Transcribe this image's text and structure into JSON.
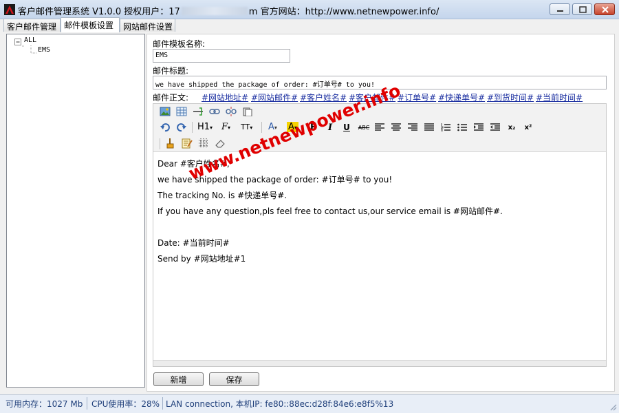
{
  "window": {
    "title_prefix": "客户邮件管理系统 V1.0.0 授权用户：17",
    "title_suffix": "m 官方网站：http://www.netnewpower.info/"
  },
  "tabs": [
    {
      "label": "客户邮件管理",
      "active": false
    },
    {
      "label": "邮件模板设置",
      "active": true
    },
    {
      "label": "网站邮件设置",
      "active": false
    }
  ],
  "tree": {
    "root": "ALL",
    "children": [
      "EMS"
    ]
  },
  "form": {
    "template_name_label": "邮件模板名称:",
    "template_name_value": "EMS",
    "subject_label": "邮件标题:",
    "subject_value": "we have shipped the package of order: #订单号# to you!",
    "body_label": "邮件正文:"
  },
  "placeholders": [
    "#网站地址#",
    "#网站邮件#",
    "#客户姓名#",
    "#客户邮件#",
    "#订单号#",
    "#快递单号#",
    "#到货时间#",
    "#当前时间#"
  ],
  "toolbar": {
    "heading_label": "H1",
    "font_label": "F",
    "size_label": "TT",
    "font_color_label": "A",
    "highlight_label": "A",
    "bold_label": "B",
    "italic_label": "I",
    "underline_label": "U",
    "strike_label": "ABC",
    "subscript_label": "x₂",
    "superscript_label": "x²"
  },
  "editor_body": [
    "Dear #客户姓名#,",
    "we have shipped the package of order: #订单号# to you!",
    "The tracking No. is #快递单号#.",
    "If you have any question,pls feel free to contact us,our service email is #网站邮件#.",
    "",
    "Date: #当前时间#",
    "Send by #网站地址#1"
  ],
  "buttons": {
    "add": "新增",
    "save": "保存"
  },
  "status": {
    "memory": "可用内存：1027 Mb",
    "cpu": "CPU使用率：28%",
    "network": "LAN connection,  本机IP: fe80::88ec:d28f:84e6:e8f5%13"
  },
  "watermark": "www.netnewpower.info",
  "colors": {
    "link": "#1a2ea0",
    "watermark": "#e00000",
    "statusbar_text": "#1f3f7a"
  }
}
